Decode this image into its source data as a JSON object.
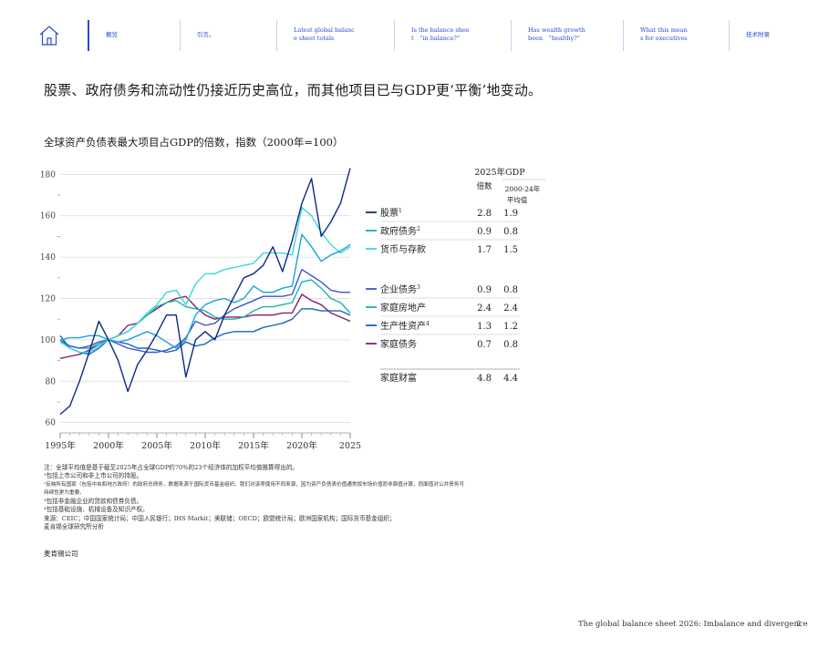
{
  "nav": {
    "items": [
      {
        "label": "概览"
      },
      {
        "label": "引言。"
      },
      {
        "label": "Latest global balanc\ne sheet totals"
      },
      {
        "label": "Is the balance shee\nt　“in balance?”"
      },
      {
        "label": "Has wealth growth\nbeen　“healthy?”"
      },
      {
        "label": "What this mean\ns for executives"
      },
      {
        "label": "技术附录"
      }
    ]
  },
  "headline": "股票、政府债务和流动性仍接近历史高位，而其他项目已与GDP更‘平衡’地变动。",
  "chart_data": {
    "type": "line",
    "title": "全球资产负债表最大项目占GDP的倍数，指数（2000年=100）",
    "xlim": [
      1995,
      2025
    ],
    "ylim": [
      55,
      185
    ],
    "yticks": [
      60,
      80,
      100,
      120,
      140,
      160,
      180
    ],
    "xticks": [
      {
        "value": 1995,
        "label": "1995年"
      },
      {
        "value": 2000,
        "label": "2000年"
      },
      {
        "value": 2005,
        "label": "2005年"
      },
      {
        "value": 2010,
        "label": "2010年"
      },
      {
        "value": 2015,
        "label": "2015年"
      },
      {
        "value": 2020,
        "label": "2020年"
      },
      {
        "value": 2025,
        "label": "2025"
      }
    ],
    "x": [
      1995,
      1996,
      1997,
      1998,
      1999,
      2000,
      2001,
      2002,
      2003,
      2004,
      2005,
      2006,
      2007,
      2008,
      2009,
      2010,
      2011,
      2012,
      2013,
      2014,
      2015,
      2016,
      2017,
      2018,
      2019,
      2020,
      2021,
      2022,
      2023,
      2024,
      2025
    ],
    "series": [
      {
        "name": "股票",
        "sup": "1",
        "color": "#0e2a80",
        "v2025": "2.8",
        "avg": "1.9",
        "values": [
          64,
          68,
          80,
          94,
          109,
          100,
          90,
          75,
          88,
          95,
          103,
          112,
          112,
          82,
          100,
          104,
          100,
          112,
          121,
          130,
          132,
          136,
          145,
          133,
          148,
          166,
          178,
          150,
          157,
          166,
          183
        ]
      },
      {
        "name": "政府债务",
        "sup": "2",
        "color": "#1aa3d9",
        "v2025": "0.9",
        "avg": "0.8",
        "values": [
          100,
          101,
          101,
          102,
          102,
          100,
          99,
          100,
          102,
          104,
          102,
          99,
          96,
          100,
          112,
          117,
          119,
          120,
          118,
          120,
          126,
          123,
          123,
          125,
          126,
          151,
          145,
          138,
          141,
          143,
          146
        ]
      },
      {
        "name": "货币与存款",
        "sup": "",
        "color": "#3ed6e0",
        "v2025": "1.7",
        "avg": "1.5",
        "values": [
          99,
          96,
          94,
          94,
          97,
          100,
          102,
          104,
          108,
          113,
          117,
          123,
          124,
          117,
          127,
          132,
          132,
          134,
          135,
          136,
          137,
          142,
          142,
          142,
          141,
          164,
          160,
          152,
          146,
          142,
          145
        ]
      },
      {
        "name": "企业债务",
        "sup": "3",
        "color": "#3a55d6",
        "v2025": "0.9",
        "avg": "0.8",
        "values": [
          100,
          97,
          96,
          97,
          99,
          100,
          98,
          96,
          95,
          94,
          94,
          95,
          97,
          101,
          109,
          107,
          108,
          112,
          115,
          117,
          119,
          121,
          121,
          121,
          122,
          134,
          131,
          128,
          124,
          123,
          123
        ]
      },
      {
        "name": "家庭房地产",
        "sup": "",
        "color": "#1db3a6",
        "v2025": "2.4",
        "avg": "2.4",
        "values": [
          99,
          97,
          96,
          96,
          98,
          100,
          102,
          104,
          108,
          112,
          116,
          118,
          119,
          116,
          115,
          114,
          111,
          110,
          110,
          111,
          114,
          116,
          116,
          117,
          118,
          128,
          129,
          125,
          120,
          118,
          113
        ]
      },
      {
        "name": "生产性资产",
        "sup": "4",
        "color": "#1766c2",
        "v2025": "1.3",
        "avg": "1.2",
        "values": [
          102,
          96,
          94,
          93,
          96,
          100,
          99,
          98,
          96,
          96,
          95,
          94,
          95,
          99,
          97,
          98,
          101,
          103,
          104,
          104,
          104,
          106,
          107,
          108,
          110,
          115,
          115,
          114,
          114,
          114,
          112
        ]
      },
      {
        "name": "家庭债务",
        "sup": "",
        "color": "#8a1f6e",
        "v2025": "0.7",
        "avg": "0.8",
        "values": [
          91,
          92,
          93,
          95,
          98,
          100,
          102,
          107,
          108,
          112,
          115,
          118,
          120,
          121,
          116,
          112,
          110,
          111,
          111,
          111,
          112,
          112,
          112,
          113,
          113,
          122,
          119,
          117,
          113,
          111,
          109
        ]
      }
    ],
    "total": {
      "name": "家庭财富",
      "v2025": "4.8",
      "avg": "4.4"
    },
    "table_header": {
      "col1_line1": "2025年GDP",
      "col1_line2": "倍数",
      "col2_line1": "2000-24年",
      "col2_line2": "平均值"
    }
  },
  "notes": [
    "注：全球平均值是基于截至2025年占全球GDP约70%的23个经济体的加权平均值推算得出的。",
    "¹包括上市公司和非上市公司的持股。",
    "²反映所有国家（包括中央和地方政府）的政府总债务，数据来源于国际货币基金组织。我们对该项使用不同来源，因为资产负债表价值通常按市场价值而非面值计算，而面值对公共债务可",
    "持续性更为重要。",
    "³包括非金融企业的贷款和债券负债。",
    "⁴包括基础设施、机械设备及知识产权。",
    "来源：CEIC；中国国家统计局；中国人民银行；IHS Markit；美联储；OECD；欧盟统计局；欧洲国家机构；国际货币基金组织；",
    "麦肯锡全球研究所分析"
  ],
  "company": "麦肯锡公司",
  "footer": {
    "title": "The global balance sheet 2026: Imbalance and divergence",
    "page": "2"
  },
  "colors": {
    "accent": "#2a4bd0",
    "nav_border": "#c9d3ea"
  }
}
